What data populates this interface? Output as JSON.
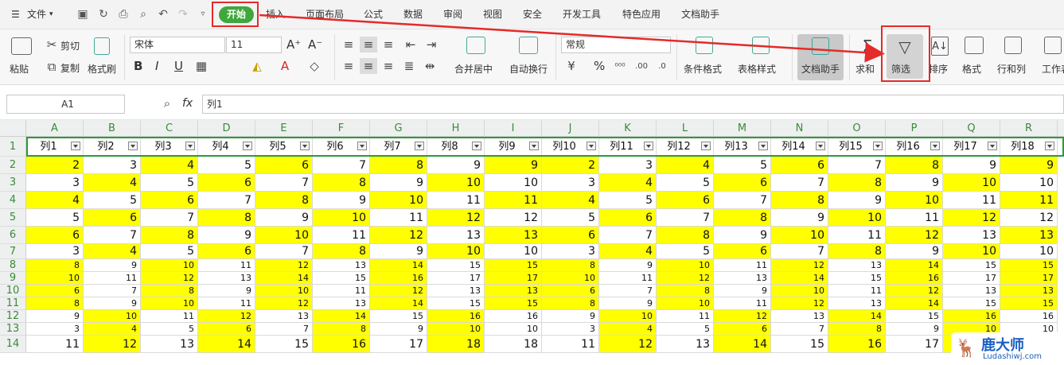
{
  "menu": {
    "file": "文件",
    "tabs": [
      "开始",
      "插入",
      "页面布局",
      "公式",
      "数据",
      "审阅",
      "视图",
      "安全",
      "开发工具",
      "特色应用",
      "文档助手"
    ]
  },
  "ribbon": {
    "paste": "粘贴",
    "cut": "剪切",
    "copy": "复制",
    "format_painter": "格式刷",
    "font_name": "宋体",
    "font_size": "11",
    "merge": "合并居中",
    "wrap": "自动换行",
    "number_format": "常规",
    "percent": "%",
    "cond_format": "条件格式",
    "table_style": "表格样式",
    "doc_helper": "文档助手",
    "sum": "求和",
    "filter": "筛选",
    "sort": "排序",
    "format": "格式",
    "rowcol": "行和列",
    "worksheet": "工作表",
    "bold": "B",
    "italic": "I",
    "underline": "U",
    "font_grow": "A⁺",
    "font_shrink": "A⁻"
  },
  "formula_bar": {
    "cell_ref": "A1",
    "fx": "fx",
    "content": "列1"
  },
  "columns": [
    "A",
    "B",
    "C",
    "D",
    "E",
    "F",
    "G",
    "H",
    "I",
    "J",
    "K",
    "L",
    "M",
    "N",
    "O",
    "P",
    "Q",
    "R"
  ],
  "headers": [
    "列1",
    "列2",
    "列3",
    "列4",
    "列5",
    "列6",
    "列7",
    "列8",
    "列9",
    "列10",
    "列11",
    "列12",
    "列13",
    "列14",
    "列15",
    "列16",
    "列17",
    "列18"
  ],
  "row_numbers": [
    "1",
    "2",
    "3",
    "4",
    "5",
    "6",
    "7",
    "8",
    "9",
    "10",
    "11",
    "12",
    "13",
    "14"
  ],
  "rows": [
    [
      2,
      3,
      4,
      5,
      6,
      7,
      8,
      9,
      9,
      2,
      3,
      4,
      5,
      6,
      7,
      8,
      9,
      9
    ],
    [
      3,
      4,
      5,
      6,
      7,
      8,
      9,
      10,
      10,
      3,
      4,
      5,
      6,
      7,
      8,
      9,
      10,
      10
    ],
    [
      4,
      5,
      6,
      7,
      8,
      9,
      10,
      11,
      11,
      4,
      5,
      6,
      7,
      8,
      9,
      10,
      11,
      11
    ],
    [
      5,
      6,
      7,
      8,
      9,
      10,
      11,
      12,
      12,
      5,
      6,
      7,
      8,
      9,
      10,
      11,
      12,
      12
    ],
    [
      6,
      7,
      8,
      9,
      10,
      11,
      12,
      13,
      13,
      6,
      7,
      8,
      9,
      10,
      11,
      12,
      13,
      13
    ],
    [
      3,
      4,
      5,
      6,
      7,
      8,
      9,
      10,
      10,
      3,
      4,
      5,
      6,
      7,
      8,
      9,
      10,
      10
    ],
    [
      8,
      9,
      10,
      11,
      12,
      13,
      14,
      15,
      15,
      8,
      9,
      10,
      11,
      12,
      13,
      14,
      15,
      15
    ],
    [
      10,
      11,
      12,
      13,
      14,
      15,
      16,
      17,
      17,
      10,
      11,
      12,
      13,
      14,
      15,
      16,
      17,
      17
    ],
    [
      6,
      7,
      8,
      9,
      10,
      11,
      12,
      13,
      13,
      6,
      7,
      8,
      9,
      10,
      11,
      12,
      13,
      13
    ],
    [
      8,
      9,
      10,
      11,
      12,
      13,
      14,
      15,
      15,
      8,
      9,
      10,
      11,
      12,
      13,
      14,
      15,
      15
    ],
    [
      9,
      10,
      11,
      12,
      13,
      14,
      15,
      16,
      16,
      9,
      10,
      11,
      12,
      13,
      14,
      15,
      16,
      16
    ],
    [
      3,
      4,
      5,
      6,
      7,
      8,
      9,
      10,
      10,
      3,
      4,
      5,
      6,
      7,
      8,
      9,
      10,
      10
    ],
    [
      11,
      12,
      13,
      14,
      15,
      16,
      17,
      18,
      18,
      11,
      12,
      13,
      14,
      15,
      16,
      17,
      18,
      18
    ]
  ],
  "yellow_pattern": [
    [
      1,
      0,
      1,
      0,
      1,
      0,
      1,
      0,
      1,
      1,
      0,
      1,
      0,
      1,
      0,
      1,
      0,
      1
    ],
    [
      0,
      1,
      0,
      1,
      0,
      1,
      0,
      1,
      0,
      0,
      1,
      0,
      1,
      0,
      1,
      0,
      1,
      0
    ],
    [
      1,
      0,
      1,
      0,
      1,
      0,
      1,
      0,
      1,
      1,
      0,
      1,
      0,
      1,
      0,
      1,
      0,
      1
    ],
    [
      0,
      1,
      0,
      1,
      0,
      1,
      0,
      1,
      0,
      0,
      1,
      0,
      1,
      0,
      1,
      0,
      1,
      0
    ],
    [
      1,
      0,
      1,
      0,
      1,
      0,
      1,
      0,
      1,
      1,
      0,
      1,
      0,
      1,
      0,
      1,
      0,
      1
    ],
    [
      0,
      1,
      0,
      1,
      0,
      1,
      0,
      1,
      0,
      0,
      1,
      0,
      1,
      0,
      1,
      0,
      1,
      0
    ],
    [
      1,
      0,
      1,
      0,
      1,
      0,
      1,
      0,
      1,
      1,
      0,
      1,
      0,
      1,
      0,
      1,
      0,
      1
    ],
    [
      1,
      0,
      1,
      0,
      1,
      0,
      1,
      0,
      1,
      1,
      0,
      1,
      0,
      1,
      0,
      1,
      0,
      1
    ],
    [
      1,
      0,
      1,
      0,
      1,
      0,
      1,
      0,
      1,
      1,
      0,
      1,
      0,
      1,
      0,
      1,
      0,
      1
    ],
    [
      1,
      0,
      1,
      0,
      1,
      0,
      1,
      0,
      1,
      1,
      0,
      1,
      0,
      1,
      0,
      1,
      0,
      1
    ],
    [
      0,
      1,
      0,
      1,
      0,
      1,
      0,
      1,
      0,
      0,
      1,
      0,
      1,
      0,
      1,
      0,
      1,
      0
    ],
    [
      0,
      1,
      0,
      1,
      0,
      1,
      0,
      1,
      0,
      0,
      1,
      0,
      1,
      0,
      1,
      0,
      1,
      0
    ],
    [
      0,
      1,
      0,
      1,
      0,
      1,
      0,
      1,
      0,
      0,
      1,
      0,
      1,
      0,
      1,
      0,
      1,
      0
    ]
  ],
  "colors": {
    "accent": "#3ea83c",
    "highlight": "#ffff00",
    "annotation": "#e52a2a"
  },
  "watermark": {
    "title": "鹿大师",
    "url": "Ludashiwj.com"
  }
}
